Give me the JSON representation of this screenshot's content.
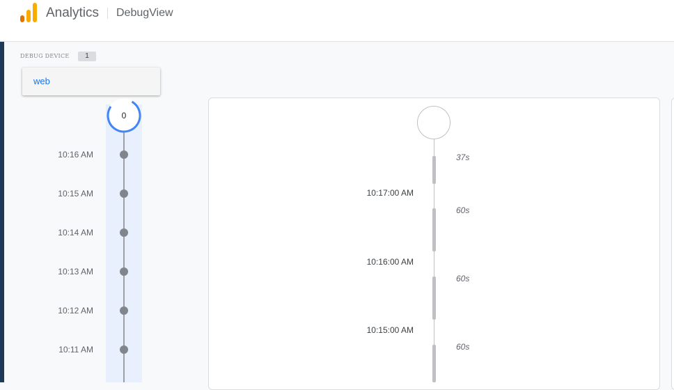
{
  "header": {
    "app_name": "Analytics",
    "page_name": "DebugView",
    "logo_colors": [
      "#f9ab00",
      "#e37400"
    ]
  },
  "debug_device": {
    "label": "DEBUG DEVICE",
    "count": "1",
    "options": [
      "web"
    ]
  },
  "minutes_stream": {
    "current_count": "0",
    "accent_color": "#4285f4",
    "times": [
      "10:16 AM",
      "10:15 AM",
      "10:14 AM",
      "10:13 AM",
      "10:12 AM",
      "10:11 AM"
    ]
  },
  "seconds_stream": {
    "durations": [
      "37s",
      "60s",
      "60s",
      "60s"
    ],
    "times": [
      "10:17:00 AM",
      "10:16:00 AM",
      "10:15:00 AM"
    ]
  }
}
